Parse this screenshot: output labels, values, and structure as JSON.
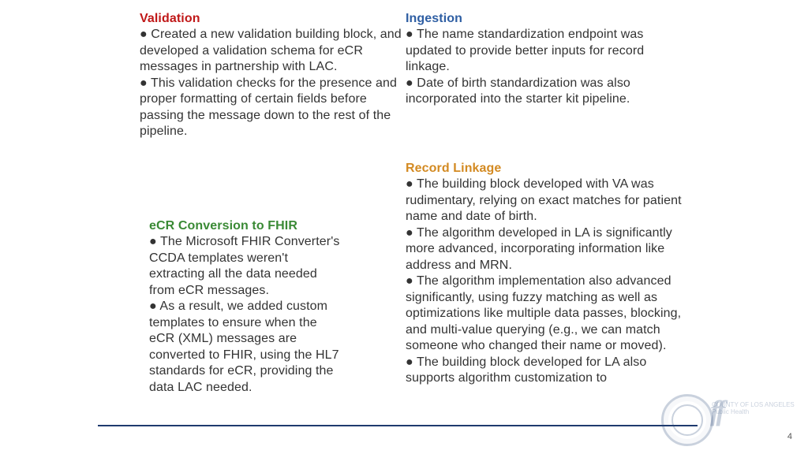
{
  "page_number": "4",
  "sections": {
    "validation": {
      "heading": "Validation",
      "body": "● Created a new validation building block, and developed a validation schema for eCR messages in partnership with LAC.\n● This validation checks for the presence and proper formatting of certain fields before passing the message down to the rest of the pipeline."
    },
    "ecr": {
      "heading": "eCR Conversion to FHIR",
      "body": "● The Microsoft FHIR Converter's CCDA templates weren't extracting all the data needed from eCR messages.\n● As a result, we added custom templates to ensure when the eCR (XML) messages are converted to FHIR, using the HL7 standards for eCR, providing the data LAC needed."
    },
    "ingestion": {
      "heading": "Ingestion",
      "body": "● The name standardization endpoint was updated to provide better inputs for record linkage.\n● Date of birth standardization was also incorporated into the starter kit pipeline."
    },
    "linkage": {
      "heading": "Record Linkage",
      "body": "● The building block developed with VA was rudimentary, relying on exact matches for patient\nname and date of birth.\n● The algorithm developed in LA is significantly more advanced, incorporating information like address and MRN.\n● The algorithm implementation also advanced\nsignificantly, using fuzzy matching as well as optimizations like multiple data passes, blocking, and multi-value querying (e.g., we can match someone who changed their name or moved).\n● The building block developed for LA also supports algorithm customization to"
    }
  },
  "watermark": {
    "org_line1": "COUNTY OF LOS ANGELES",
    "org_line2": "Public Health"
  }
}
